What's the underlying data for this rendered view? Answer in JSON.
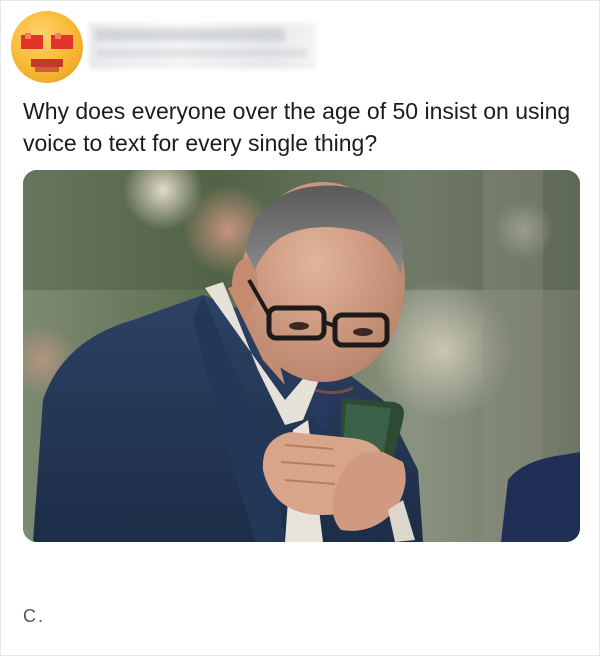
{
  "post": {
    "text": "Why does everyone over the age of 50 insist on using voice to text for every single thing?"
  },
  "footer": {
    "mark": "C."
  },
  "icons": {
    "avatar": "pixelated-emoji-avatar",
    "photo": "man-squinting-at-phone-photo"
  }
}
